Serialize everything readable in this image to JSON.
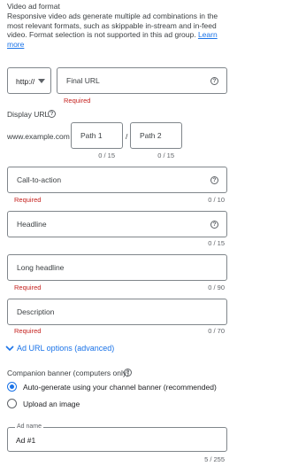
{
  "video_ad_format": {
    "title": "Video ad format",
    "description": "Responsive video ads generate multiple ad combinations in the most relevant formats, such as skippable in-stream and in-feed video. Format selection is not supported in this ad group.",
    "learn_more": "Learn more"
  },
  "final_url": {
    "protocol": "http://",
    "placeholder": "Final URL",
    "error": "Required"
  },
  "display_url": {
    "label": "Display URL",
    "domain": "www.example.com /",
    "separator": "/",
    "path1": {
      "placeholder": "Path 1",
      "count": "0 / 15"
    },
    "path2": {
      "placeholder": "Path 2",
      "count": "0 / 15"
    }
  },
  "call_to_action": {
    "placeholder": "Call-to-action",
    "error": "Required",
    "count": "0 / 10"
  },
  "headline": {
    "placeholder": "Headline",
    "count": "0 / 15"
  },
  "long_headline": {
    "placeholder": "Long headline",
    "error": "Required",
    "count": "0 / 90"
  },
  "description": {
    "placeholder": "Description",
    "error": "Required",
    "count": "0 / 70"
  },
  "ad_url_options": {
    "label": "Ad URL options (advanced)"
  },
  "companion_banner": {
    "label": "Companion banner (computers only)",
    "options": [
      {
        "label": "Auto-generate using your channel banner (recommended)",
        "selected": true
      },
      {
        "label": "Upload an image",
        "selected": false
      }
    ]
  },
  "ad_name": {
    "label": "Ad name",
    "value": "Ad #1",
    "count": "5 / 255"
  },
  "colors": {
    "accent": "#1a73e8",
    "error": "#c5221f",
    "border": "#80868b"
  }
}
